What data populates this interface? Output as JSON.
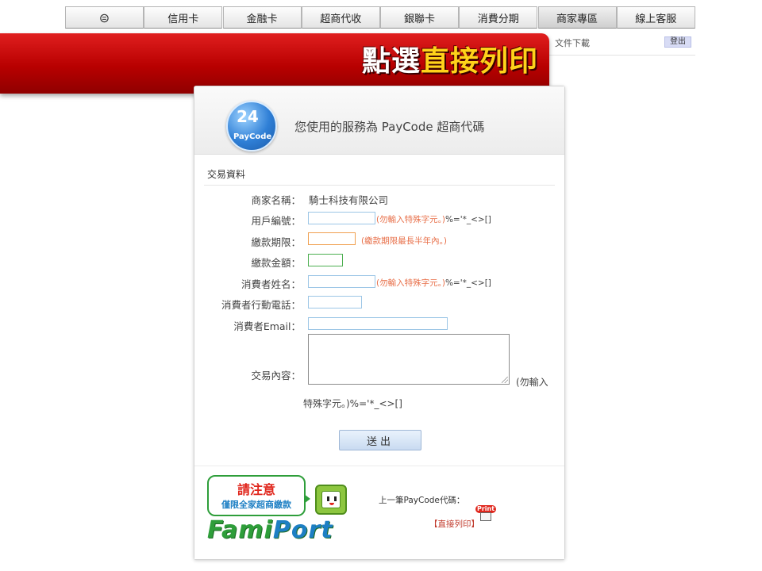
{
  "nav": {
    "logo_glyph": "⊜",
    "tabs": [
      "信用卡",
      "金融卡",
      "超商代收",
      "銀聯卡",
      "消費分期",
      "商家專區",
      "線上客服"
    ],
    "active": "商家專區"
  },
  "subbar": {
    "download": "文件下載",
    "logout": "登出"
  },
  "banner": {
    "white": "點選",
    "yellow": "直接列印"
  },
  "header": {
    "logo_number": "24",
    "logo_word": "PayCode",
    "title": "您使用的服務為 PayCode 超商代碼"
  },
  "section": {
    "title": "交易資料"
  },
  "form": {
    "merchant_label": "商家名稱：",
    "merchant_value": "騎士科技有限公司",
    "account_label": "用戶編號：",
    "account_hint": "(勿輸入特殊字元。)",
    "account_chars": "%='*_<>[]",
    "deadline_label": "繳款期限：",
    "deadline_hint": "(繳款期限最長半年內。)",
    "amount_label": "繳款金額：",
    "name_label": "消費者姓名：",
    "name_hint": "(勿輸入特殊字元。)",
    "name_chars": "%='*_<>[]",
    "phone_label": "消費者行動電話：",
    "email_label": "消費者Email：",
    "content_label": "交易內容：",
    "content_hint_1": "(勿輸入",
    "content_hint_2": "特殊字元。)%='*_<>[]",
    "submit": "送出"
  },
  "notice": {
    "title": "請注意",
    "subtitle": "僅限全家超商繳款",
    "brand_a": "Fami",
    "brand_b": "Port"
  },
  "previous": {
    "label": "上一筆PayCode代碼：",
    "badge": "Print",
    "link": "【直接列印】"
  }
}
